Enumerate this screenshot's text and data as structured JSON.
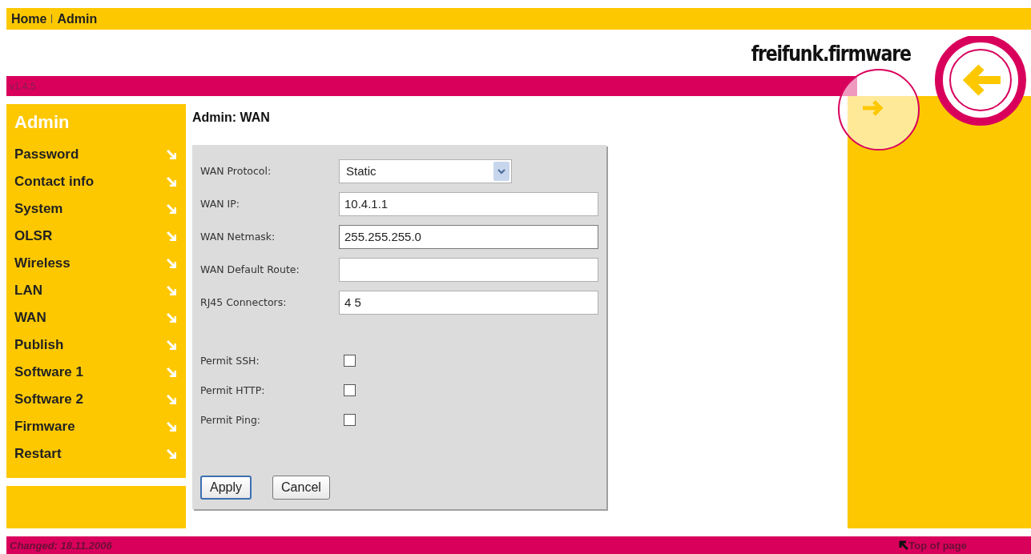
{
  "breadcrumb": [
    {
      "label": "Home"
    },
    {
      "label": "Admin"
    }
  ],
  "logo": {
    "text": "freifunk.firmware"
  },
  "version": "v1.4.5",
  "sidebar": {
    "title": "Admin",
    "items": [
      {
        "label": "Password"
      },
      {
        "label": "Contact info"
      },
      {
        "label": "System"
      },
      {
        "label": "OLSR"
      },
      {
        "label": "Wireless"
      },
      {
        "label": "LAN"
      },
      {
        "label": "WAN"
      },
      {
        "label": "Publish"
      },
      {
        "label": "Software 1"
      },
      {
        "label": "Software 2"
      },
      {
        "label": "Firmware"
      },
      {
        "label": "Restart"
      }
    ]
  },
  "page_title": "Admin: WAN",
  "form": {
    "fields": [
      {
        "kind": "select",
        "label": "WAN Protocol:",
        "value": "Static"
      },
      {
        "kind": "text",
        "label": "WAN IP:",
        "value": "10.4.1.1"
      },
      {
        "kind": "text",
        "label": "WAN Netmask:",
        "value": "255.255.255.0",
        "focused": true
      },
      {
        "kind": "text",
        "label": "WAN Default Route:"
      },
      {
        "kind": "text",
        "label": "RJ45 Connectors:",
        "value": "4 5"
      },
      {
        "kind": "checkbox",
        "label": "Permit SSH:",
        "checked": false
      },
      {
        "kind": "checkbox",
        "label": "Permit HTTP:",
        "checked": false
      },
      {
        "kind": "checkbox",
        "label": "Permit Ping:",
        "checked": false
      }
    ],
    "buttons": [
      {
        "label": "Apply",
        "default": true
      },
      {
        "label": "Cancel",
        "default": false
      }
    ]
  },
  "footer": {
    "changed": "Changed: 18.11.2006",
    "top_link": "Top of page"
  }
}
